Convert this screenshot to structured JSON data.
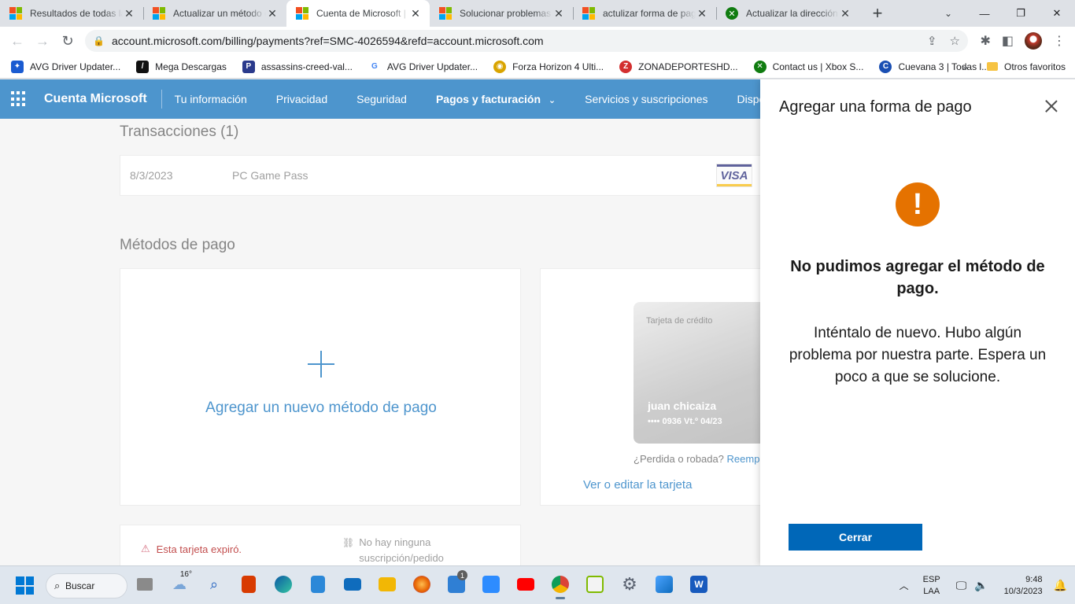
{
  "browser": {
    "tabs": [
      {
        "label": "Resultados de todas las",
        "icon": "microsoft-icon",
        "active": false
      },
      {
        "label": "Actualizar un método de",
        "icon": "microsoft-icon",
        "active": false
      },
      {
        "label": "Cuenta de Microsoft | Pagos",
        "icon": "microsoft-icon",
        "active": true
      },
      {
        "label": "Solucionar problemas",
        "icon": "microsoft-icon",
        "active": false
      },
      {
        "label": "actulizar forma de pago",
        "icon": "microsoft-icon",
        "active": false
      },
      {
        "label": "Actualizar la dirección",
        "icon": "xbox-icon",
        "active": false
      }
    ],
    "url": "account.microsoft.com/billing/payments?ref=SMC-4026594&refd=account.microsoft.com",
    "bookmarks": [
      {
        "label": "AVG Driver Updater...",
        "icon": "avg-icon",
        "color": "#1a5bd1"
      },
      {
        "label": "Mega Descargas",
        "icon": "mega-icon",
        "color": "#111111"
      },
      {
        "label": "assassins-creed-val...",
        "icon": "pf-icon",
        "color": "#2a3a8c"
      },
      {
        "label": "AVG Driver Updater...",
        "icon": "google-icon",
        "color": "#ffffff"
      },
      {
        "label": "Forza Horizon 4 Ulti...",
        "icon": "forza-icon",
        "color": "#d9a400"
      },
      {
        "label": "ZONADEPORTESHD...",
        "icon": "zd-icon",
        "color": "#d32f2f"
      },
      {
        "label": "Contact us | Xbox S...",
        "icon": "xbox-icon",
        "color": "#107c10"
      },
      {
        "label": "Cuevana 3 | Todas l...",
        "icon": "cuevana-icon",
        "color": "#1a4fb3"
      }
    ],
    "other_bookmarks": "Otros favoritos"
  },
  "msnav": {
    "brand": "Cuenta Microsoft",
    "items": [
      "Tu información",
      "Privacidad",
      "Seguridad",
      "Pagos y facturación",
      "Servicios y suscripciones",
      "Dispositivos"
    ]
  },
  "transactions": {
    "title": "Transacciones (1)",
    "row": {
      "date": "8/3/2023",
      "description": "PC Game Pass",
      "brand": "VISA"
    }
  },
  "payment_methods": {
    "title": "Métodos de pago",
    "add_label": "Agregar un nuevo método de pago",
    "card": {
      "type": "Tarjeta de crédito",
      "holder": "juan chicaiza",
      "number": "•••• 0936 Vt.º 04/23"
    },
    "lost_text": "¿Perdida o robada?",
    "replace_link": "Reemplazar",
    "edit_link": "Ver o editar la tarjeta",
    "expired": "Esta tarjeta expiró.",
    "no_subscription": [
      "No hay ninguna",
      "suscripción/pedido"
    ]
  },
  "panel": {
    "title": "Agregar una forma de pago",
    "icon": "!",
    "error_title": "No pudimos agregar el método de pago.",
    "error_text": "Inténtalo de nuevo. Hubo algún problema por nuestra parte. Espera un poco a que se solucione.",
    "close_button": "Cerrar"
  },
  "taskbar": {
    "search": "Buscar",
    "temperature": "16°",
    "badge": "1",
    "lang_top": "ESP",
    "lang_bottom": "LAA",
    "time": "9:48",
    "date": "10/3/2023"
  }
}
